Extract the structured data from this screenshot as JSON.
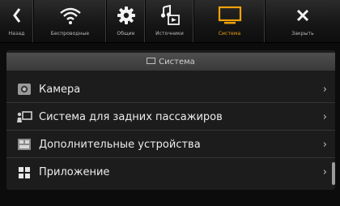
{
  "topbar": {
    "back_label": "Назад",
    "wifi_label": "Беспроводные",
    "general_label": "Общие",
    "sources_label": "Источники",
    "system_label": "Система",
    "close_label": "Закрыть"
  },
  "active_tab": "Система",
  "accent_color": "#f0a20a",
  "panel": {
    "header": "Система",
    "items": [
      {
        "label": "Камера",
        "icon": "camera-icon"
      },
      {
        "label": "Система для задних пассажиров",
        "icon": "rear-entertainment-icon"
      },
      {
        "label": "Дополнительные устройства",
        "icon": "devices-icon"
      },
      {
        "label": "Приложение",
        "icon": "apps-grid-icon"
      }
    ]
  }
}
